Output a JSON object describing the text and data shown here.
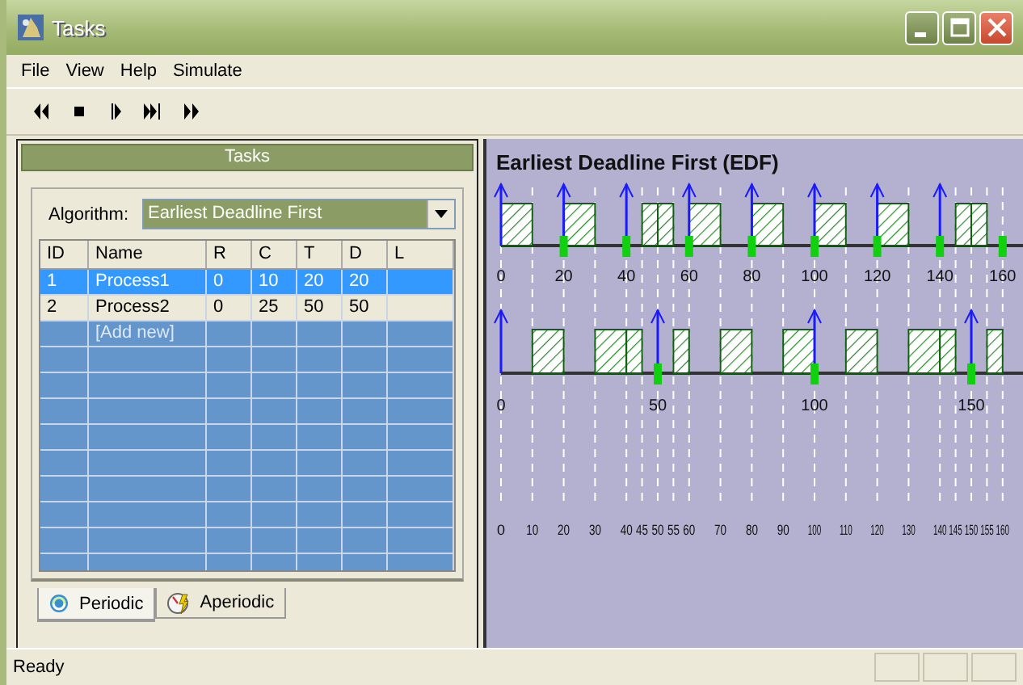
{
  "window": {
    "title": "Tasks"
  },
  "menu": [
    "File",
    "View",
    "Help",
    "Simulate"
  ],
  "toolbar": [
    {
      "kind": "rewind"
    },
    {
      "kind": "stop"
    },
    {
      "kind": "step"
    },
    {
      "kind": "step_end"
    },
    {
      "kind": "forward"
    }
  ],
  "tasks_panel": {
    "title": "Tasks",
    "algorithm_label": "Algorithm:",
    "algorithm": "Earliest Deadline First",
    "table": {
      "columns": [
        "ID",
        "Name",
        "R",
        "C",
        "T",
        "D",
        "L"
      ],
      "rows": [
        {
          "cells": [
            "1",
            "Process1",
            "0",
            "10",
            "20",
            "20"
          ],
          "selected": true
        },
        {
          "cells": [
            "2",
            "Process2",
            "0",
            "25",
            "50",
            "50"
          ],
          "selected": false
        }
      ],
      "add_new": "[Add new]"
    },
    "tabs": [
      {
        "label": "Periodic",
        "kind": "periodic",
        "selected": true
      },
      {
        "label": "Aperiodic",
        "kind": "aperiodic",
        "selected": false
      }
    ]
  },
  "timeline": {
    "title": "Earliest Deadline First (EDF)",
    "rows": [
      {
        "ticks": [
          "0",
          "20",
          "40",
          "60",
          "80",
          "100",
          "120",
          "140",
          "160"
        ]
      },
      {
        "ticks": [
          "0",
          "50",
          "100",
          "150"
        ]
      }
    ],
    "time_ticks": [
      "0",
      "10",
      "20",
      "30",
      "40",
      "45",
      "50",
      "55",
      "60",
      "70",
      "80",
      "90",
      "100",
      "110",
      "120",
      "130",
      "140",
      "145",
      "150",
      "155",
      "160"
    ]
  },
  "status_bar": {
    "text": "Ready"
  }
}
